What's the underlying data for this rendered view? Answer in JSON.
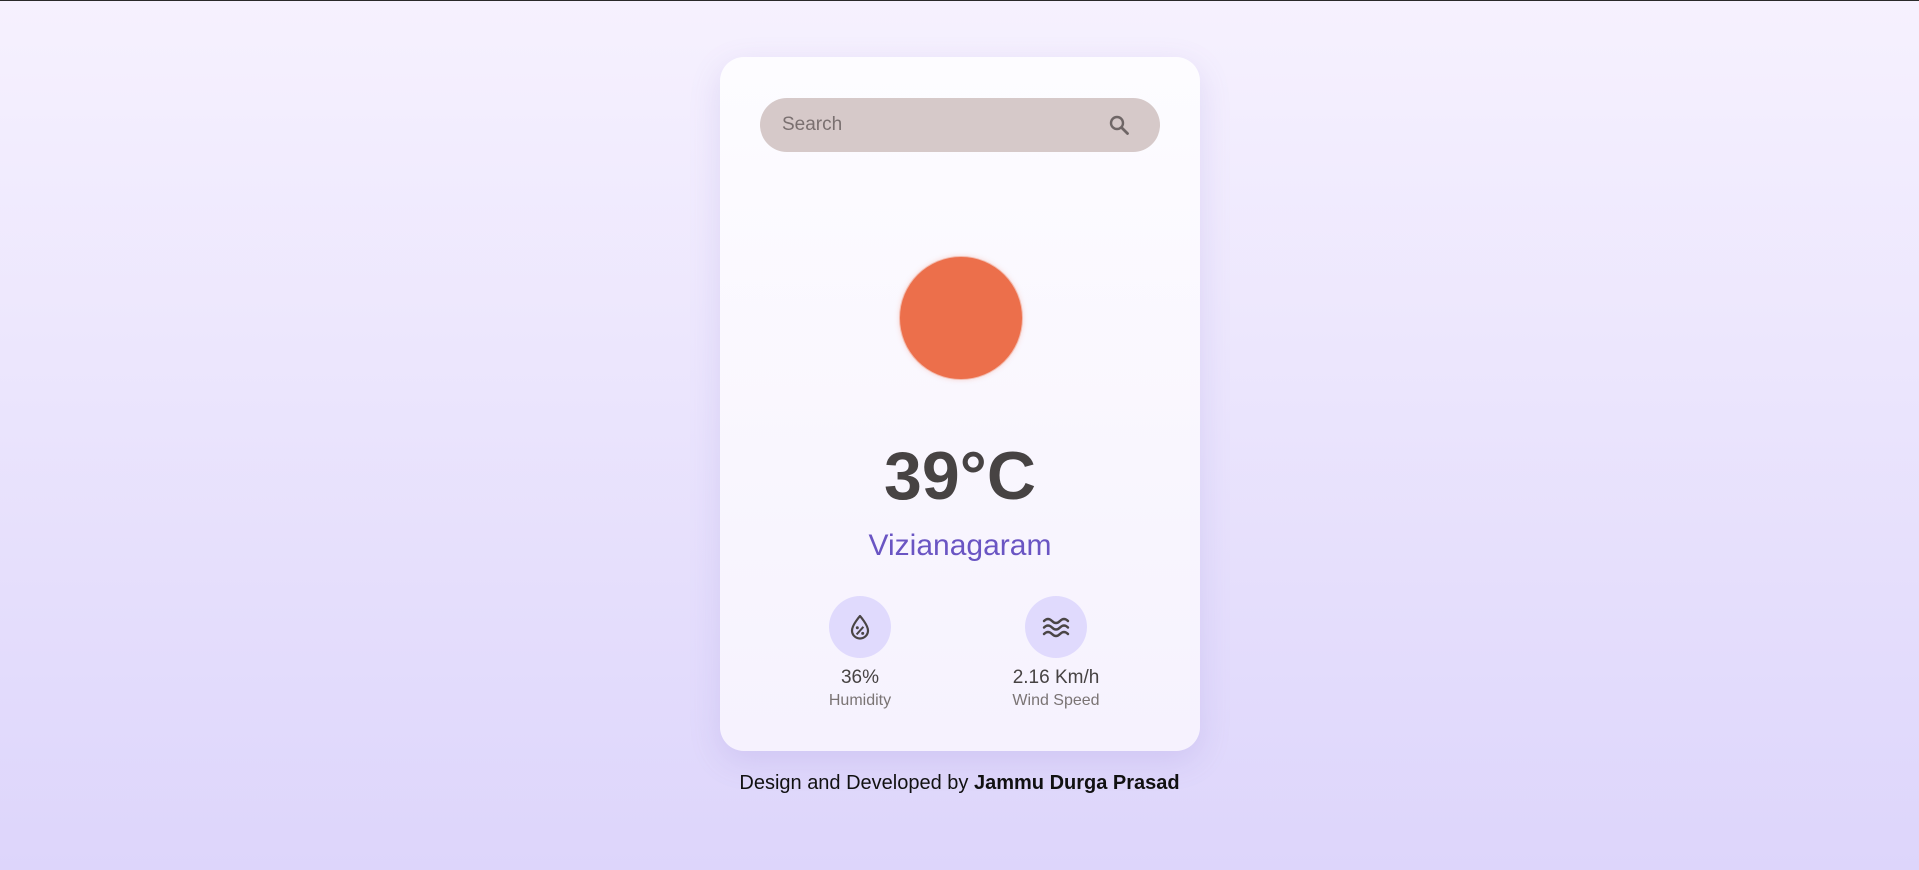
{
  "search": {
    "placeholder": "Search",
    "value": "",
    "icon": "search-icon"
  },
  "weather": {
    "icon": "sun-icon",
    "icon_color": "#ec6f4b",
    "temperature": "39°C",
    "city": "Vizianagaram",
    "city_color": "#6a55c3"
  },
  "stats": {
    "humidity": {
      "icon": "humidity-drop-icon",
      "value": "36%",
      "label": "Humidity"
    },
    "wind": {
      "icon": "wind-waves-icon",
      "value": "2.16 Km/h",
      "label": "Wind Speed"
    }
  },
  "footer": {
    "prefix": "Design and Developed by ",
    "author": "Jammu Durga Prasad"
  }
}
